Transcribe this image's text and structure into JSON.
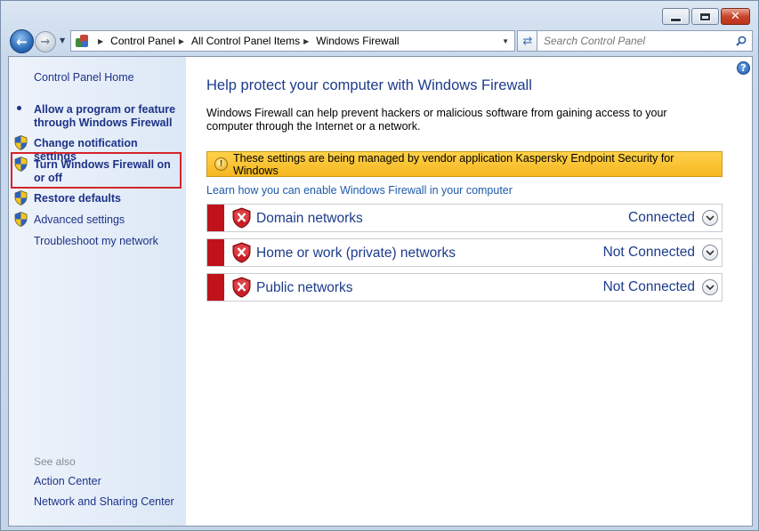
{
  "window": {
    "caption": {
      "minimize": "minimize",
      "maximize": "maximize",
      "close": "✕"
    }
  },
  "navbar": {
    "breadcrumbs": [
      "Control Panel",
      "All Control Panel Items",
      "Windows Firewall"
    ],
    "search_placeholder": "Search Control Panel"
  },
  "sidebar": {
    "home": "Control Panel Home",
    "tasks": [
      {
        "label": "Allow a program or feature through Windows Firewall",
        "icon": "bullet"
      },
      {
        "label": "Change notification settings",
        "icon": "uac-shield-icon"
      },
      {
        "label": "Turn Windows Firewall on or off",
        "icon": "uac-shield-icon",
        "highlighted": true
      },
      {
        "label": "Restore defaults",
        "icon": "uac-shield-icon"
      }
    ],
    "links": [
      {
        "label": "Advanced settings",
        "icon": "uac-shield-icon"
      },
      {
        "label": "Troubleshoot my network"
      }
    ],
    "see_also": {
      "heading": "See also",
      "items": [
        "Action Center",
        "Network and Sharing Center"
      ]
    }
  },
  "main": {
    "title": "Help protect your computer with Windows Firewall",
    "description": "Windows Firewall can help prevent hackers or malicious software from gaining access to your computer through the Internet or a network.",
    "warning": "These settings are being managed by vendor application Kaspersky Endpoint Security for Windows",
    "learn_link": "Learn how you can enable Windows Firewall in your computer",
    "networks": [
      {
        "name": "Domain networks",
        "status": "Connected"
      },
      {
        "name": "Home or work (private) networks",
        "status": "Not Connected"
      },
      {
        "name": "Public networks",
        "status": "Not Connected"
      }
    ]
  },
  "colors": {
    "link_blue": "#1e3287",
    "title_blue": "#1d3b8a",
    "warning_yellow": "#f5b721",
    "alert_red": "#c0121a",
    "highlight_box": "#d4242b"
  }
}
